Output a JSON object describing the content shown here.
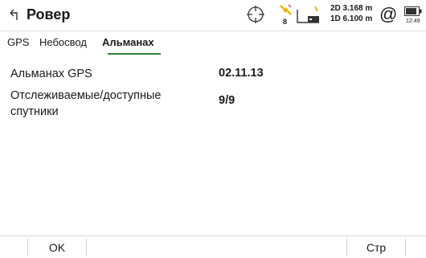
{
  "header": {
    "title": "Ровер",
    "back_icon": "back-arrow-icon",
    "satellite_count": "8",
    "precision_2d": "2D 3.168 m",
    "precision_1d": "1D 6.100 m",
    "at_symbol": "@",
    "clock": "12:49",
    "accent_color": "#2e7d32"
  },
  "tabs": [
    {
      "label": "GPS",
      "active": false
    },
    {
      "label": "Небосвод",
      "active": false
    },
    {
      "label": "Альманах",
      "active": true
    }
  ],
  "fields": [
    {
      "label": "Альманах GPS",
      "value": "02.11.13"
    },
    {
      "label": "Отслеживаемые/доступные",
      "label2": "спутники",
      "value": "9/9"
    }
  ],
  "softkeys": {
    "ok": "OK",
    "page": "Стр"
  }
}
